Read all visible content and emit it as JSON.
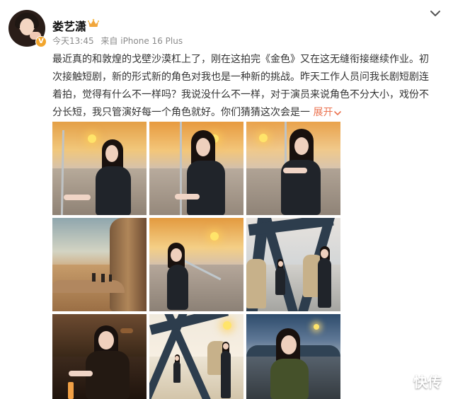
{
  "user": {
    "name": "娄艺潇",
    "verified_badge": "V",
    "badge_icon": "crown-icon"
  },
  "meta": {
    "time": "今天13:45",
    "source": "来自 iPhone 16 Plus"
  },
  "post": {
    "lines": [
      "最近真的和敦煌的戈壁沙漠杠上了，刚在这拍完《金色》又在这无缝衔接继续作业。初",
      "次接触短剧，新的形式新的角色对我也是一种新的挑战。昨天工作人员问我长剧短剧连",
      "着拍，觉得有什么不一样吗？我说没什么不一样，对于演员来说角色不分大小，戏份不",
      "分长短，我只管演好每一个角色就好。你们猜猜这次会是一"
    ],
    "expand_label": "展开"
  },
  "watermark": "快传",
  "colors": {
    "accent": "#eb7350",
    "meta": "#8b8b8b",
    "text": "#333333"
  }
}
